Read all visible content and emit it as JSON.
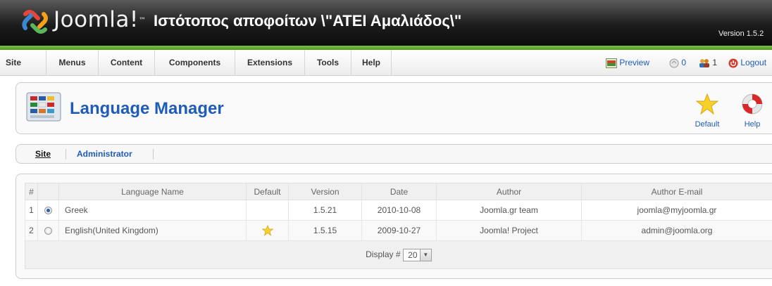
{
  "header": {
    "brand": "Joomla!",
    "brand_mark": "™",
    "site_title": "Ιστότοπος αποφοίτων \\\"ΑΤΕΙ Αμαλιάδος\\\"",
    "version": "Version 1.5.2"
  },
  "menu": {
    "items": [
      "Site",
      "Menus",
      "Content",
      "Components",
      "Extensions",
      "Tools",
      "Help"
    ]
  },
  "status": {
    "preview": "Preview",
    "messages_count": "0",
    "users_count": "1",
    "logout": "Logout"
  },
  "toolbar": {
    "title": "Language Manager",
    "default_label": "Default",
    "help_label": "Help"
  },
  "submenu": {
    "site": "Site",
    "administrator": "Administrator"
  },
  "table": {
    "columns": [
      "#",
      "",
      "Language Name",
      "Default",
      "Version",
      "Date",
      "Author",
      "Author E-mail"
    ],
    "rows": [
      {
        "num": "1",
        "checked": true,
        "name": "Greek",
        "is_default": false,
        "version": "1.5.21",
        "date": "2010-10-08",
        "author": "Joomla.gr team",
        "email": "joomla@myjoomla.gr"
      },
      {
        "num": "2",
        "checked": false,
        "name": "English(United Kingdom)",
        "is_default": true,
        "version": "1.5.15",
        "date": "2009-10-27",
        "author": "Joomla! Project",
        "email": "admin@joomla.org"
      }
    ],
    "display_label": "Display #",
    "display_value": "20"
  },
  "colors": {
    "link": "#1f5cb8",
    "green_bar": "#6bb232",
    "header_bg": "#1c1c1c"
  }
}
